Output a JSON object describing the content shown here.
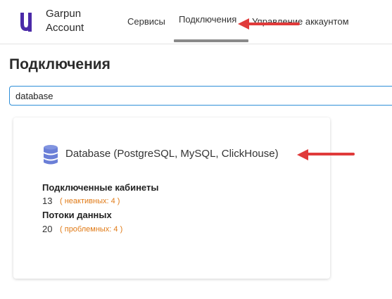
{
  "header": {
    "brand_line1": "Garpun",
    "brand_line2": "Account",
    "tabs": [
      {
        "label": "Сервисы",
        "active": false
      },
      {
        "label": "Подключения",
        "active": true
      },
      {
        "label": "Управление аккаунтом",
        "active": false
      }
    ]
  },
  "main": {
    "title": "Подключения",
    "search": {
      "value": "database",
      "placeholder": ""
    },
    "card": {
      "icon": "database-icon",
      "title": "Database (PostgreSQL, MySQL, ClickHouse)",
      "cabinets_label": "Подключенные кабинеты",
      "cabinets_count": "13",
      "cabinets_note": "неактивных: 4",
      "flows_label": "Потоки данных",
      "flows_count": "20",
      "flows_note": "проблемных: 4"
    }
  },
  "colors": {
    "accent_blue": "#2f8fd8",
    "logo_purple": "#4b2aa8",
    "note_orange": "#e07a16",
    "annotation_red": "#e03a3a",
    "db_icon_blue": "#6b7fd7"
  }
}
